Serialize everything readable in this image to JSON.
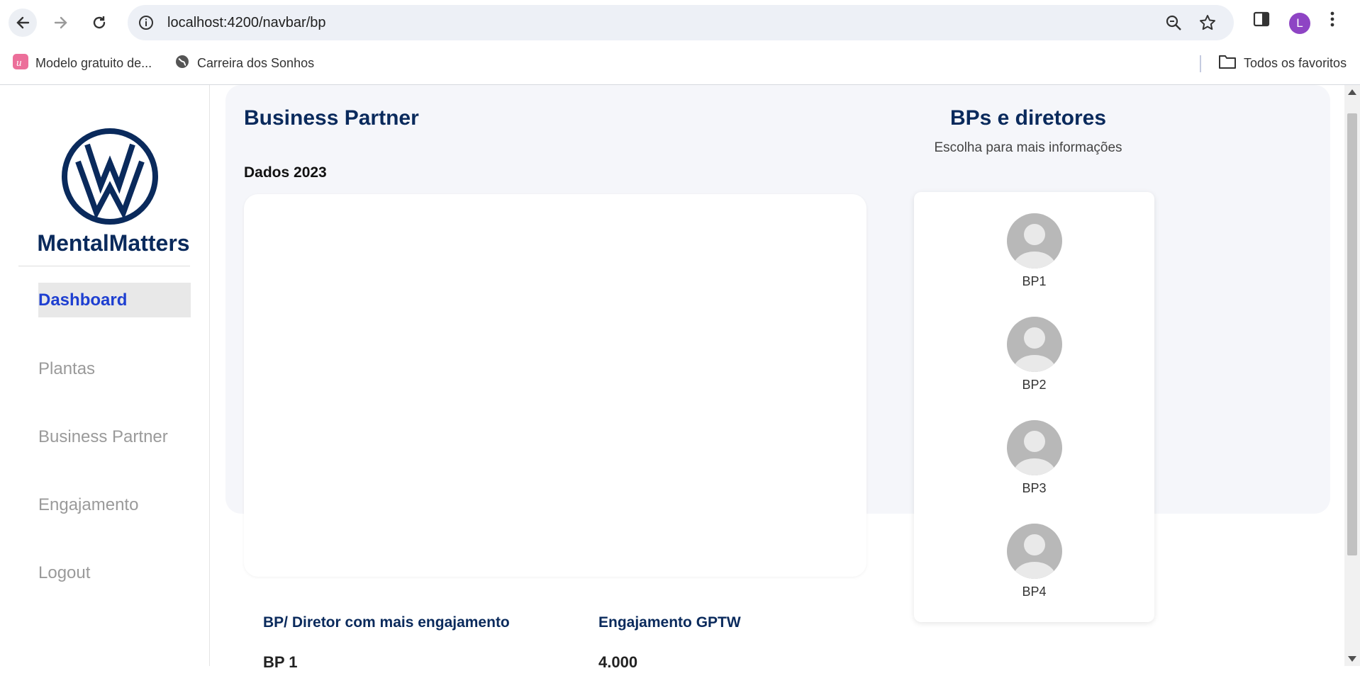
{
  "browser": {
    "url": "localhost:4200/navbar/bp",
    "profile_initial": "L",
    "bookmarks": [
      {
        "label": "Modelo gratuito de..."
      },
      {
        "label": "Carreira dos Sonhos"
      }
    ],
    "all_bookmarks_label": "Todos os favoritos"
  },
  "sidebar": {
    "brand": "MentalMatters",
    "items": [
      {
        "label": "Dashboard",
        "active": true
      },
      {
        "label": "Plantas"
      },
      {
        "label": "Business Partner"
      },
      {
        "label": "Engajamento"
      },
      {
        "label": "Logout"
      }
    ]
  },
  "main": {
    "title": "Business Partner",
    "data_label": "Dados 2023",
    "bp_panel": {
      "title": "BPs e diretores",
      "subtitle": "Escolha para mais informações",
      "items": [
        {
          "label": "BP1"
        },
        {
          "label": "BP2"
        },
        {
          "label": "BP3"
        },
        {
          "label": "BP4"
        }
      ]
    },
    "stats": [
      {
        "heading": "BP/ Diretor com mais engajamento",
        "value": "BP 1"
      },
      {
        "heading": "Engajamento GPTW",
        "value": "4.000"
      }
    ]
  },
  "colors": {
    "brand_navy": "#0a2a5c",
    "active_link": "#1e3fd1",
    "panel_bg": "#f5f6fa"
  }
}
